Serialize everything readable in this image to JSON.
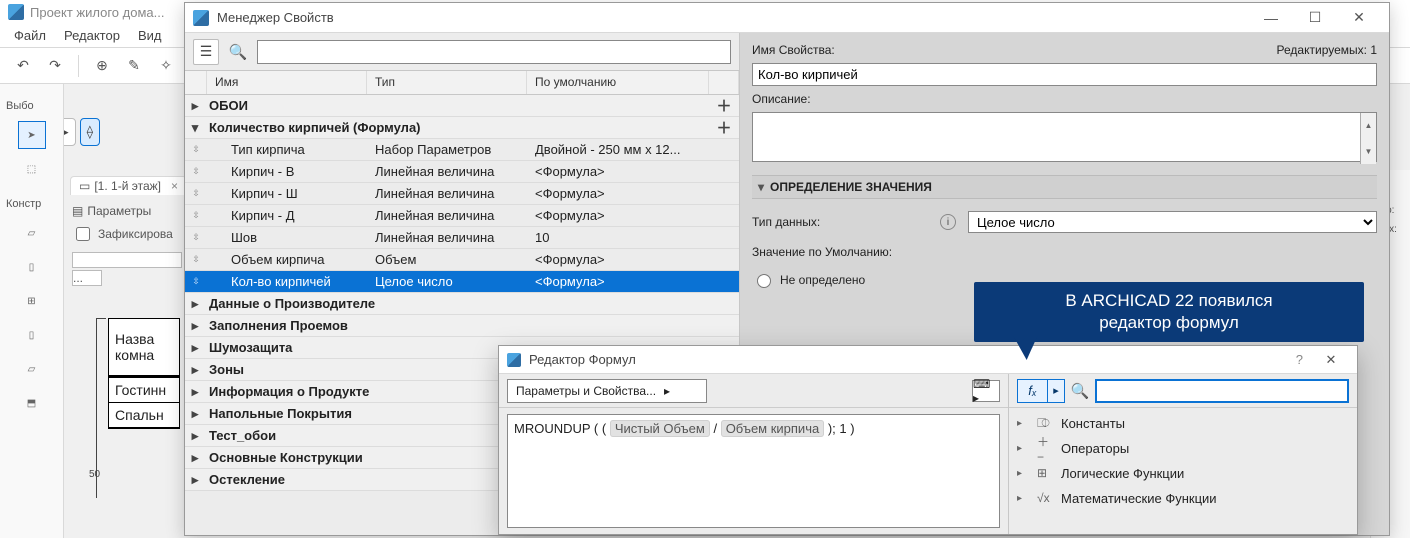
{
  "main_window": {
    "title": "Проект жилого дома...",
    "menu": [
      "Файл",
      "Редактор",
      "Вид"
    ],
    "doc_tab": "[1. 1-й этаж]",
    "side_label_select": "Выбо",
    "side_label_constr": "Констр",
    "params_header": "Параметры",
    "fix_checkbox": "Зафиксирова",
    "room_header_l1": "Назва",
    "room_header_l2": "комна",
    "rooms": [
      "Гостинн",
      "Спальн"
    ],
    "ruler_val": "50",
    "right_labels": [
      "ано:",
      "мых:"
    ]
  },
  "pm": {
    "title": "Менеджер Свойств",
    "property_name_label": "Имя Свойства:",
    "editable_count_label": "Редактируемых: 1",
    "property_name_value": "Кол-во кирпичей",
    "desc_label": "Описание:",
    "desc_value": "",
    "section_def": "ОПРЕДЕЛЕНИЕ ЗНАЧЕНИЯ",
    "datatype_label": "Тип данных:",
    "datatype_value": "Целое число",
    "default_label": "Значение по Умолчанию:",
    "radio_undef": "Не определено",
    "columns": {
      "name": "Имя",
      "type": "Тип",
      "def": "По умолчанию"
    },
    "tree": [
      {
        "kind": "group",
        "exp": "▸",
        "name": "ОБОИ",
        "add": true
      },
      {
        "kind": "group",
        "exp": "▾",
        "name": "Количество кирпичей (Формула)",
        "add": true
      },
      {
        "kind": "item",
        "name": "Тип кирпича",
        "type": "Набор Параметров",
        "def": "Двойной - 250 мм x 12..."
      },
      {
        "kind": "item",
        "name": "Кирпич - В",
        "type": "Линейная величина",
        "def": "<Формула>"
      },
      {
        "kind": "item",
        "name": "Кирпич - Ш",
        "type": "Линейная величина",
        "def": "<Формула>"
      },
      {
        "kind": "item",
        "name": "Кирпич - Д",
        "type": "Линейная величина",
        "def": "<Формула>"
      },
      {
        "kind": "item",
        "name": "Шов",
        "type": "Линейная величина",
        "def": "10"
      },
      {
        "kind": "item",
        "name": "Объем кирпича",
        "type": "Объем",
        "def": "<Формула>"
      },
      {
        "kind": "item",
        "name": "Кол-во кирпичей",
        "type": "Целое число",
        "def": "<Формула>",
        "selected": true
      },
      {
        "kind": "group",
        "exp": "▸",
        "name": "Данные о Производителе"
      },
      {
        "kind": "group",
        "exp": "▸",
        "name": "Заполнения Проемов"
      },
      {
        "kind": "group",
        "exp": "▸",
        "name": "Шумозащита"
      },
      {
        "kind": "group",
        "exp": "▸",
        "name": "Зоны"
      },
      {
        "kind": "group",
        "exp": "▸",
        "name": "Информация о Продукте"
      },
      {
        "kind": "group",
        "exp": "▸",
        "name": "Напольные Покрытия"
      },
      {
        "kind": "group",
        "exp": "▸",
        "name": "Тест_обои"
      },
      {
        "kind": "group",
        "exp": "▸",
        "name": "Основные Конструкции"
      },
      {
        "kind": "group",
        "exp": "▸",
        "name": "Остекление"
      }
    ]
  },
  "fe": {
    "title": "Редактор Формул",
    "param_btn": "Параметры и Свойства...",
    "kb_label": "⌨ ▸",
    "fx_label": "fₓ",
    "formula_prefix": "MROUNDUP ( ( ",
    "token1": "Чистый Объем",
    "sep1": " / ",
    "token2": "Объем кирпича",
    "suffix": " ); 1 )",
    "fn_groups": [
      {
        "icon": "⎄",
        "label": "Константы"
      },
      {
        "icon": "＋−",
        "label": "Операторы"
      },
      {
        "icon": "⊞",
        "label": "Логические Функции"
      },
      {
        "icon": "√x",
        "label": "Математические Функции"
      }
    ]
  },
  "callout": {
    "line1": "В ARCHICAD 22 появился",
    "line2": "редактор формул"
  }
}
